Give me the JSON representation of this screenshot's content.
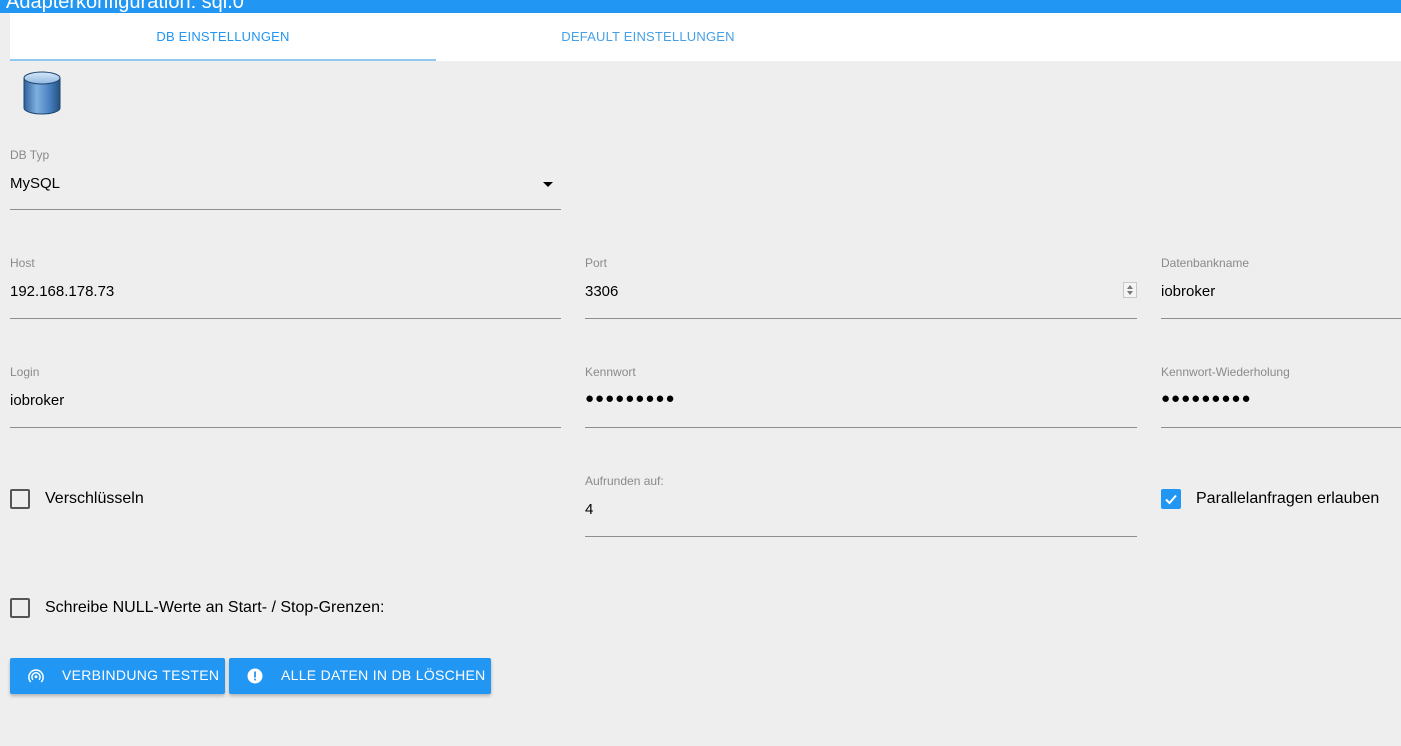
{
  "window": {
    "title": "Adapterkonfiguration: sql.0"
  },
  "tabs": [
    {
      "label": "DB EINSTELLUNGEN",
      "active": true
    },
    {
      "label": "DEFAULT EINSTELLUNGEN",
      "active": false
    }
  ],
  "logo": {
    "icon": "database-icon"
  },
  "fields": {
    "db_type": {
      "label": "DB Typ",
      "value": "MySQL"
    },
    "host": {
      "label": "Host",
      "value": "192.168.178.73"
    },
    "port": {
      "label": "Port",
      "value": "3306"
    },
    "db_name": {
      "label": "Datenbankname",
      "value": "iobroker"
    },
    "login": {
      "label": "Login",
      "value": "iobroker"
    },
    "password": {
      "label": "Kennwort",
      "value": "●●●●●●●●●"
    },
    "password_repeat": {
      "label": "Kennwort-Wiederholung",
      "value": "●●●●●●●●●"
    },
    "round": {
      "label": "Aufrunden auf:",
      "value": "4"
    }
  },
  "checkboxes": {
    "encrypt": {
      "label": "Verschlüsseln",
      "checked": false
    },
    "parallel": {
      "label": "Parallelanfragen erlauben",
      "checked": true
    },
    "write_null": {
      "label": "Schreibe NULL-Werte an Start- / Stop-Grenzen:",
      "checked": false
    }
  },
  "buttons": {
    "test": {
      "label": "VERBINDUNG TESTEN",
      "icon": "wifi-tethering-icon"
    },
    "delete": {
      "label": "ALLE DATEN IN DB LÖSCHEN",
      "icon": "alert-circle-icon"
    }
  },
  "colors": {
    "accent": "#2196f3",
    "background": "#eeeeee"
  }
}
